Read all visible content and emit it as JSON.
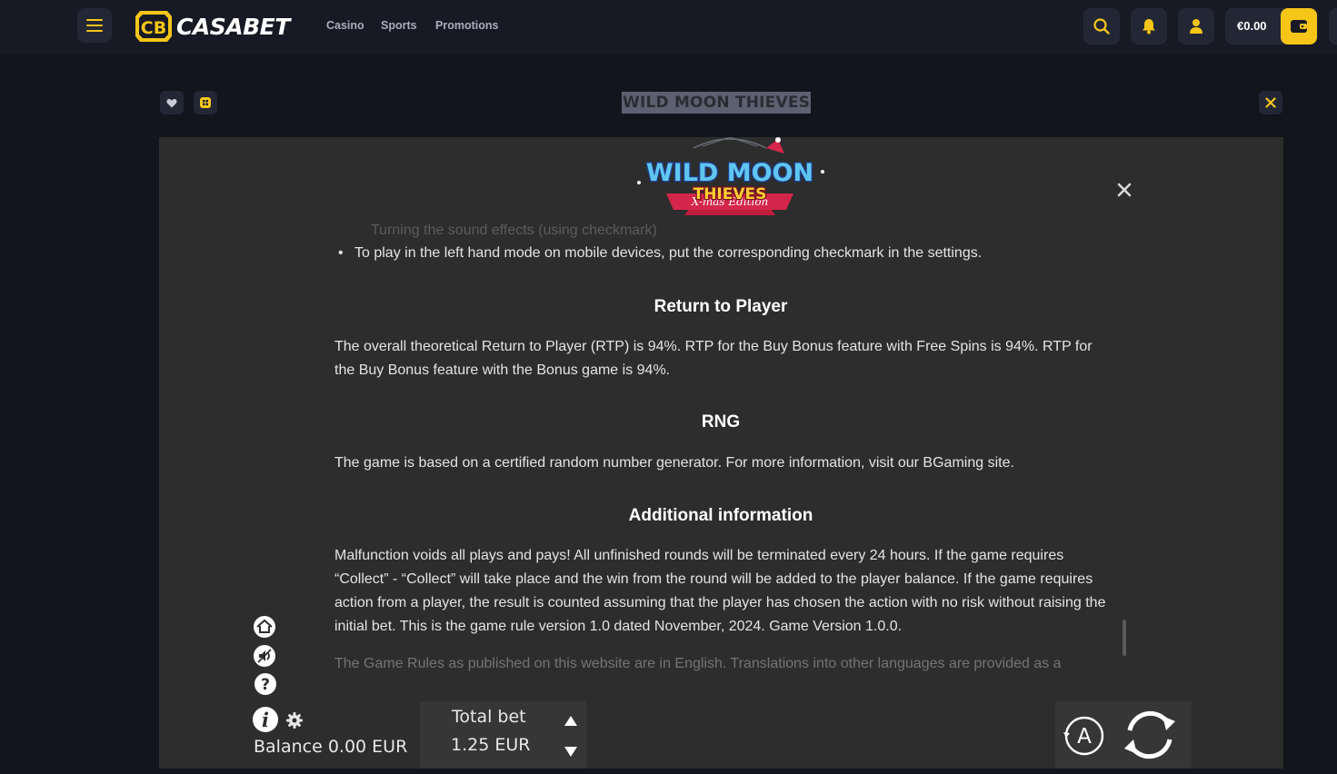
{
  "brand": {
    "logo_mark": "CB",
    "name_part1": "CASA",
    "name_part2": "BET"
  },
  "nav": {
    "links": [
      "Casino",
      "Sports",
      "Promotions"
    ]
  },
  "header_icons": [
    "menu-icon",
    "search-icon",
    "bell-icon",
    "user-icon",
    "wallet-icon"
  ],
  "wallet": {
    "balance": "€0.00"
  },
  "colors": {
    "accent": "#f5c518",
    "background": "#13151d",
    "game_bg": "#2d2d2d"
  },
  "game": {
    "title": "WILD MOON THIEVES",
    "logo": {
      "line1": "WILD MOON",
      "line2": "THIEVES",
      "line3": "X-mas Edition"
    }
  },
  "rules": {
    "faded_item": "Turning the sound effects (using checkmark)",
    "bullet": "To play in the left hand mode on mobile devices, put the corresponding checkmark in the settings.",
    "rtp_heading": "Return to Player",
    "rtp_text": "The overall theoretical Return to Player (RTP) is 94%. RTP for the Buy Bonus feature with Free Spins is 94%. RTP for the Buy Bonus feature with the Bonus game is 94%.",
    "rng_heading": "RNG",
    "rng_text": "The game is based on a certified random number generator. For more information, visit our BGaming site.",
    "additional_heading": "Additional information",
    "additional_text": "Malfunction voids all plays and pays! All unfinished rounds will be terminated every 24 hours. If the game requires “Collect” - “Collect” will take place and the win from the round will be added to the player balance. If the game requires action from a player, the result is counted assuming that the player has chosen the action with no risk without raising the initial bet. This is the game rule version 1.0 dated November, 2024. Game Version 1.0.0.",
    "translation_text": "The Game Rules as published on this website are in English. Translations into other languages are provided as a"
  },
  "controls": {
    "balance": "Balance 0.00 EUR",
    "total_bet_label": "Total bet",
    "total_bet_value": "1.25 EUR",
    "auto_label": "A"
  }
}
